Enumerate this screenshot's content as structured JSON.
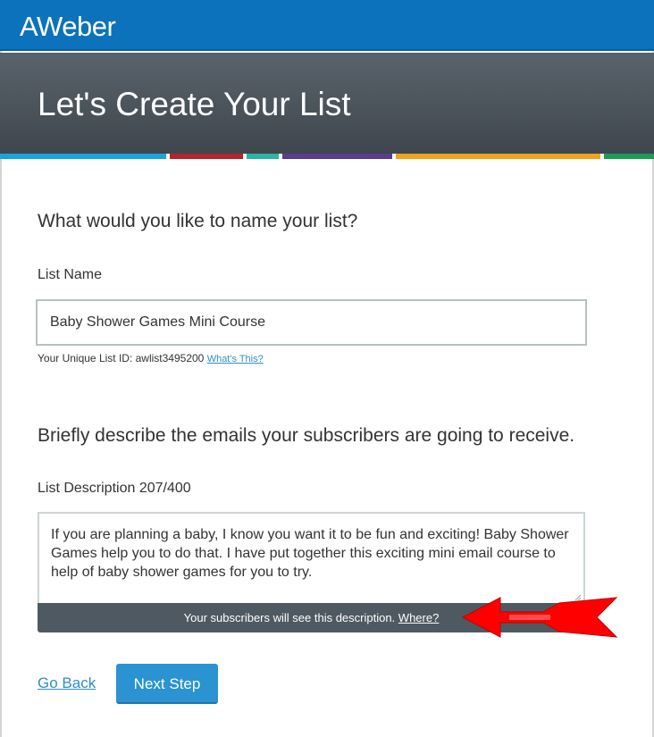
{
  "brand": {
    "logo": "AWeber"
  },
  "hero": {
    "title": "Let's Create Your List"
  },
  "stripes": [
    {
      "color": "#1aa3dd",
      "width": 186
    },
    {
      "color": "#b1252b",
      "width": 82
    },
    {
      "color": "#2ab5a5",
      "width": 36
    },
    {
      "color": "#5a3c90",
      "width": 123
    },
    {
      "color": "#f0a21c",
      "width": 229
    },
    {
      "color": "#1e9b55",
      "width": 56
    }
  ],
  "name_section": {
    "heading": "What would you like to name your list?",
    "label": "List Name",
    "value": "Baby Shower Games Mini Course",
    "uid_text": "Your Unique List ID: awlist3495200",
    "uid_link": "What's This?"
  },
  "desc_section": {
    "heading": "Briefly describe the emails your subscribers are going to receive.",
    "label": "List Description 207/400",
    "value": "If you are planning a baby, I know you want it to be fun and exciting! Baby Shower Games help you to do that. I have put together this exciting mini email course to help of baby shower games for you to try.",
    "note_text": "Your subscribers will see this description.",
    "note_link": "Where?"
  },
  "actions": {
    "back": "Go Back",
    "next": "Next Step"
  },
  "colors": {
    "accent": "#2b93d1",
    "brand_blue": "#0b72bb",
    "arrow": "#ff0000"
  }
}
